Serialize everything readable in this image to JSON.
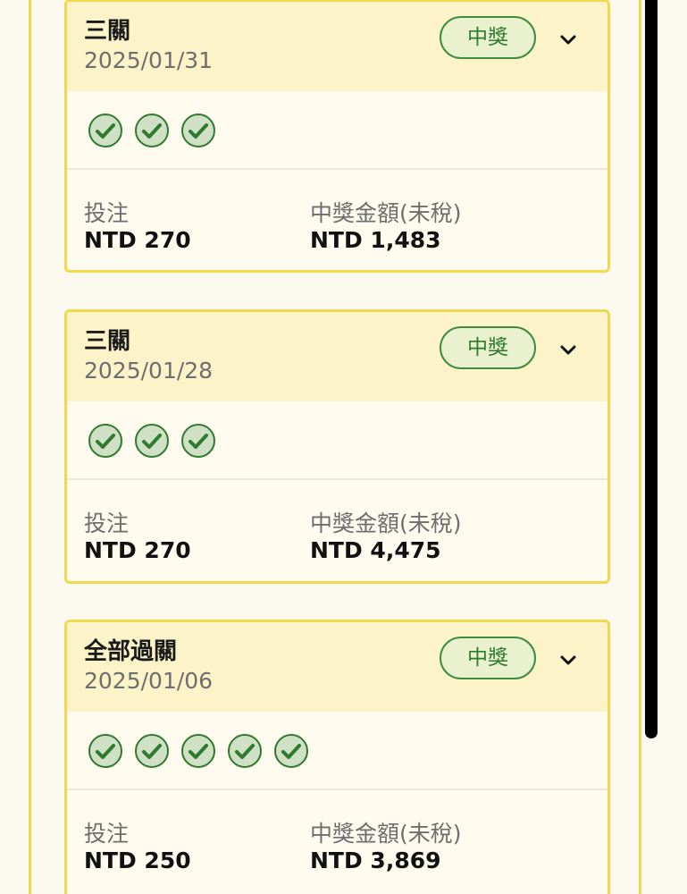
{
  "bets": [
    {
      "title": "三關",
      "date": "2025/01/31",
      "status": "中獎",
      "legs": 3,
      "stake_label": "投注",
      "stake": "NTD 270",
      "payout_label": "中獎金額(未稅)",
      "payout": "NTD 1,483"
    },
    {
      "title": "三關",
      "date": "2025/01/28",
      "status": "中獎",
      "legs": 3,
      "stake_label": "投注",
      "stake": "NTD 270",
      "payout_label": "中獎金額(未稅)",
      "payout": "NTD 4,475"
    },
    {
      "title": "全部過關",
      "date": "2025/01/06",
      "status": "中獎",
      "legs": 5,
      "stake_label": "投注",
      "stake": "NTD 250",
      "payout_label": "中獎金額(未稅)",
      "payout": "NTD 3,869"
    }
  ],
  "colors": {
    "accent_border": "#f2d84c",
    "header_bg": "#fcf3c8",
    "win_green": "#2f7a2f",
    "check_fill": "#cfe0c4"
  },
  "icons": {
    "check": "check-circle-icon",
    "expand": "chevron-down-icon"
  }
}
